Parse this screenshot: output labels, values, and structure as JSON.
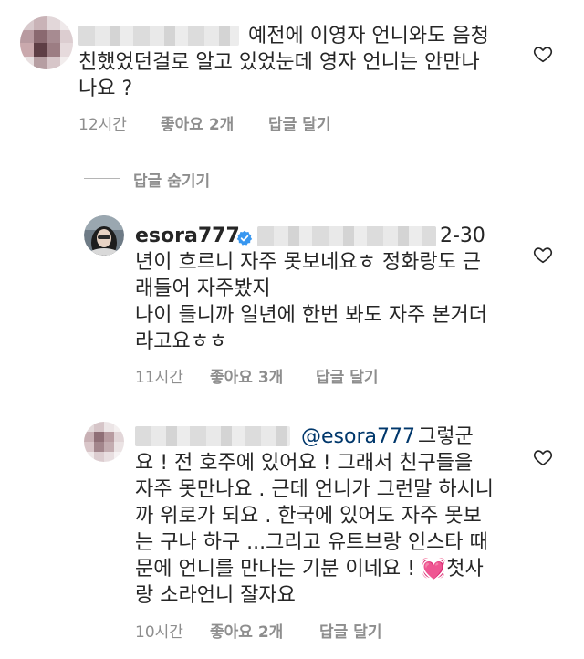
{
  "comment1": {
    "lines": [
      "예전에 이영자 언니와도 음청",
      "친했었던걸로 알고 있었눈데 영자 언니는 안만나",
      "나요 ?"
    ],
    "time": "12시간",
    "likes": "좋아요 2개",
    "reply": "답글 달기"
  },
  "hide_replies": "답글 숨기기",
  "comment2": {
    "username": "esora777",
    "first_line_suffix": "2-30",
    "lines": [
      "년이 흐르니 자주 못보네요ㅎ 정화랑도 근",
      "래들어 자주봤지",
      "나이 들니까 일년에 한번 봐도 자주 본거더",
      "라고요ㅎㅎ"
    ],
    "time": "11시간",
    "likes": "좋아요 3개",
    "reply": "답글 달기"
  },
  "comment3": {
    "mention": "@esora777",
    "first_line_suffix": "그렇군",
    "lines": [
      "요 !  전 호주에 있어요 ! 그래서 친구들을",
      "자주 못만나요 . 근데 언니가 그런말 하시니",
      "까 위로가 되요 . 한국에 있어도 자주 못보",
      "는 구나 하구 ...그리고 유트브랑 인스타 때",
      "문에 언니를 만나는 기분 이네요 ! 💓첫사",
      "랑 소라언니 잘자요"
    ],
    "time": "10시간",
    "likes": "좋아요 2개",
    "reply": "답글 달기"
  }
}
